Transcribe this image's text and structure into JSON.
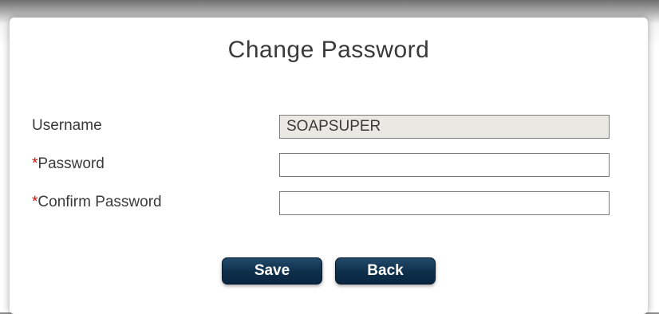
{
  "dialog": {
    "title": "Change Password",
    "fields": {
      "username": {
        "label": "Username",
        "value": "SOAPSUPER"
      },
      "password": {
        "required_mark": "*",
        "label": "Password",
        "value": ""
      },
      "confirm_password": {
        "required_mark": "*",
        "label": "Confirm Password",
        "value": ""
      }
    },
    "buttons": {
      "save_label": "Save",
      "back_label": "Back"
    }
  },
  "colors": {
    "required": "#cc1111",
    "button_bg": "#0e2f4b",
    "readonly_bg": "#e9e8e3"
  }
}
